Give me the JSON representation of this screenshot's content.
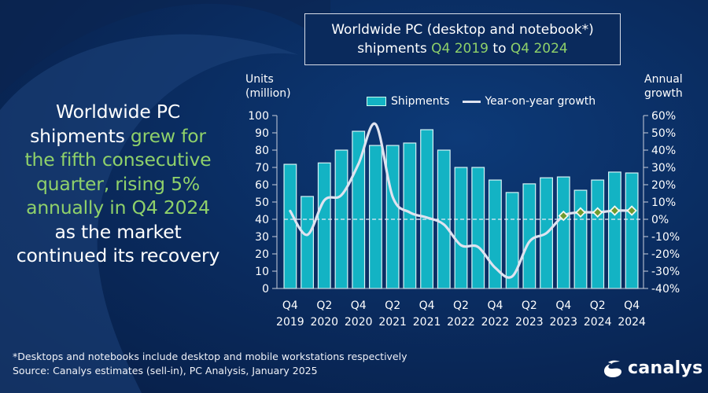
{
  "title": {
    "line1": "Worldwide PC (desktop and notebook*)",
    "line2_prefix": "shipments ",
    "line2_start": "Q4 2019",
    "line2_mid": " to ",
    "line2_end": "Q4 2024"
  },
  "headline": {
    "part1": "Worldwide PC shipments ",
    "part2_highlight": "grew for the fifth consecutive quarter, rising 5% annually in Q4 2024",
    "part3": " as the market continued its recovery"
  },
  "colors": {
    "bar": "#13b3c4",
    "bar_border": "#d6f2f5",
    "line": "#dfe3f0",
    "marker": "#6f9a2e",
    "highlight_text": "#8fd16a",
    "background": "#0a2c60"
  },
  "footnote": {
    "line1": "*Desktops and notebooks include desktop and mobile workstations respectively",
    "line2": "Source: Canalys estimates (sell-in), PC Analysis, January 2025"
  },
  "logo": {
    "text": "canalys",
    "icon": "canalys-swoosh-icon"
  },
  "chart_data": {
    "type": "bar",
    "title": "Worldwide PC (desktop and notebook*) shipments Q4 2019 to Q4 2024",
    "ylabel": "Units (million)",
    "y2label": "Annual growth",
    "ylim": [
      0,
      100
    ],
    "y2lim": [
      -40,
      60
    ],
    "yticks": [
      "0",
      "10",
      "20",
      "30",
      "40",
      "50",
      "60",
      "70",
      "80",
      "90",
      "100"
    ],
    "y2ticks": [
      "-40%",
      "-30%",
      "-20%",
      "-10%",
      "0%",
      "10%",
      "20%",
      "30%",
      "40%",
      "50%",
      "60%"
    ],
    "legend": [
      "Shipments",
      "Year-on-year growth"
    ],
    "legend_position": "top-center",
    "grid": false,
    "categories": [
      "Q4 2019",
      "Q1 2020",
      "Q2 2020",
      "Q3 2020",
      "Q4 2020",
      "Q1 2021",
      "Q2 2021",
      "Q3 2021",
      "Q4 2021",
      "Q1 2022",
      "Q2 2022",
      "Q3 2022",
      "Q4 2022",
      "Q1 2023",
      "Q2 2023",
      "Q3 2023",
      "Q4 2023",
      "Q1 2024",
      "Q2 2024",
      "Q3 2024",
      "Q4 2024"
    ],
    "xtick_labels": [
      {
        "index": 0,
        "q": "Q4",
        "y": "2019"
      },
      {
        "index": 2,
        "q": "Q2",
        "y": "2020"
      },
      {
        "index": 4,
        "q": "Q4",
        "y": "2020"
      },
      {
        "index": 6,
        "q": "Q2",
        "y": "2021"
      },
      {
        "index": 8,
        "q": "Q4",
        "y": "2021"
      },
      {
        "index": 10,
        "q": "Q2",
        "y": "2022"
      },
      {
        "index": 12,
        "q": "Q4",
        "y": "2022"
      },
      {
        "index": 14,
        "q": "Q2",
        "y": "2023"
      },
      {
        "index": 16,
        "q": "Q4",
        "y": "2023"
      },
      {
        "index": 18,
        "q": "Q2",
        "y": "2024"
      },
      {
        "index": 20,
        "q": "Q4",
        "y": "2024"
      }
    ],
    "series": [
      {
        "name": "Shipments",
        "type": "bar",
        "axis": "left",
        "values": [
          71.8,
          53.2,
          72.6,
          80.0,
          90.9,
          82.7,
          82.7,
          84.1,
          91.8,
          80.0,
          70.0,
          70.0,
          62.7,
          55.5,
          60.5,
          64.0,
          64.5,
          56.8,
          62.7,
          67.3,
          66.8
        ]
      },
      {
        "name": "Year-on-year growth",
        "type": "line",
        "axis": "right",
        "unit": "%",
        "values": [
          4.8,
          -9,
          11,
          14,
          32,
          55,
          13,
          4,
          1,
          -3,
          -15,
          -16,
          -28,
          -33,
          -13,
          -8,
          2,
          4,
          4,
          5,
          5
        ],
        "markers_from_index": 16
      }
    ],
    "reference_line": {
      "axis": "right",
      "value": 0,
      "style": "dashed"
    }
  }
}
